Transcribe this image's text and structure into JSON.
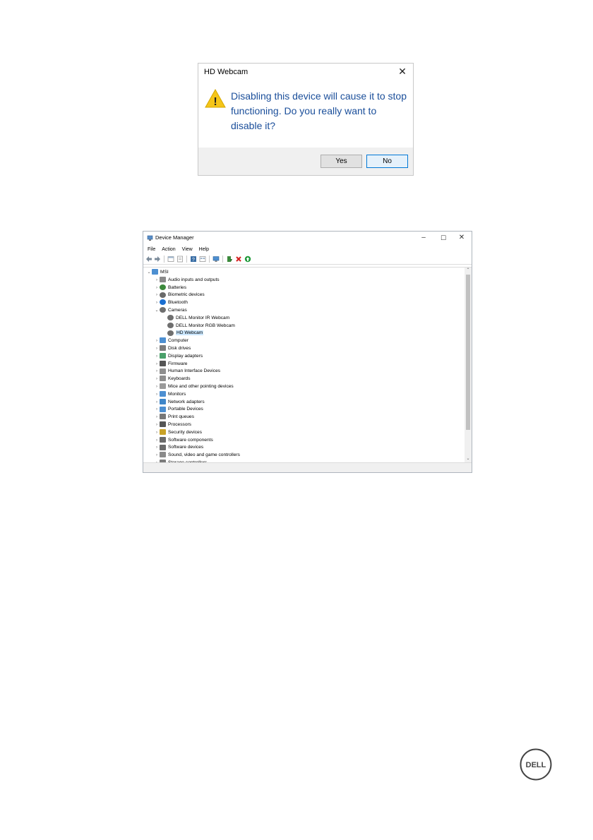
{
  "dialog": {
    "title": "HD Webcam",
    "message": "Disabling this device will cause it to stop functioning. Do you really want to disable it?",
    "yes_label": "Yes",
    "no_label": "No",
    "close_glyph": "✕",
    "warning_glyph": "!",
    "colors": {
      "message": "#1a4e9a",
      "warning": "#f5c518"
    }
  },
  "device_manager": {
    "title": "Device Manager",
    "window_buttons": {
      "minimize": "–",
      "maximize": "☐",
      "close": "✕"
    },
    "menus": [
      "File",
      "Action",
      "View",
      "Help"
    ],
    "toolbar_icons": [
      "back-arrow-icon",
      "forward-arrow-icon",
      "properties-icon",
      "console-tree-icon",
      "help-icon",
      "view-icon",
      "monitor-icon",
      "update-driver-icon",
      "uninstall-icon",
      "enable-device-icon"
    ],
    "tree": [
      {
        "label": "MSI",
        "level": 0,
        "arrow": "⌄",
        "icon": "computer-icon"
      },
      {
        "label": "Audio inputs and outputs",
        "level": 1,
        "arrow": "›",
        "icon": "speaker-icon"
      },
      {
        "label": "Batteries",
        "level": 1,
        "arrow": "›",
        "icon": "battery-icon"
      },
      {
        "label": "Biometric devices",
        "level": 1,
        "arrow": "›",
        "icon": "fingerprint-icon"
      },
      {
        "label": "Bluetooth",
        "level": 1,
        "arrow": "›",
        "icon": "bluetooth-icon"
      },
      {
        "label": "Cameras",
        "level": 1,
        "arrow": "⌄",
        "icon": "camera-icon"
      },
      {
        "label": "DELL Monitor IR Webcam",
        "level": 2,
        "arrow": "",
        "icon": "camera-icon"
      },
      {
        "label": "DELL Monitor RGB Webcam",
        "level": 2,
        "arrow": "",
        "icon": "camera-icon"
      },
      {
        "label": "HD Webcam",
        "level": 2,
        "arrow": "",
        "icon": "camera-icon",
        "selected": true
      },
      {
        "label": "Computer",
        "level": 1,
        "arrow": "›",
        "icon": "monitor-icon"
      },
      {
        "label": "Disk drives",
        "level": 1,
        "arrow": "›",
        "icon": "disk-icon"
      },
      {
        "label": "Display adapters",
        "level": 1,
        "arrow": "›",
        "icon": "display-adapter-icon"
      },
      {
        "label": "Firmware",
        "level": 1,
        "arrow": "›",
        "icon": "chip-icon"
      },
      {
        "label": "Human Interface Devices",
        "level": 1,
        "arrow": "›",
        "icon": "keyboard-icon"
      },
      {
        "label": "Keyboards",
        "level": 1,
        "arrow": "›",
        "icon": "keyboard-icon"
      },
      {
        "label": "Mice and other pointing devices",
        "level": 1,
        "arrow": "›",
        "icon": "mouse-icon"
      },
      {
        "label": "Monitors",
        "level": 1,
        "arrow": "›",
        "icon": "monitor-icon"
      },
      {
        "label": "Network adapters",
        "level": 1,
        "arrow": "›",
        "icon": "network-icon"
      },
      {
        "label": "Portable Devices",
        "level": 1,
        "arrow": "›",
        "icon": "portable-device-icon"
      },
      {
        "label": "Print queues",
        "level": 1,
        "arrow": "›",
        "icon": "printer-icon"
      },
      {
        "label": "Processors",
        "level": 1,
        "arrow": "›",
        "icon": "chip-icon"
      },
      {
        "label": "Security devices",
        "level": 1,
        "arrow": "›",
        "icon": "key-icon"
      },
      {
        "label": "Software components",
        "level": 1,
        "arrow": "›",
        "icon": "puzzle-icon"
      },
      {
        "label": "Software devices",
        "level": 1,
        "arrow": "›",
        "icon": "device-icon"
      },
      {
        "label": "Sound, video and game controllers",
        "level": 1,
        "arrow": "›",
        "icon": "speaker-icon"
      },
      {
        "label": "Storage controllers",
        "level": 1,
        "arrow": "›",
        "icon": "storage-icon"
      }
    ],
    "scrollbar": {
      "position_fraction": 0.0,
      "visible_fraction": 0.87
    }
  },
  "logo": {
    "text": "DELL"
  }
}
